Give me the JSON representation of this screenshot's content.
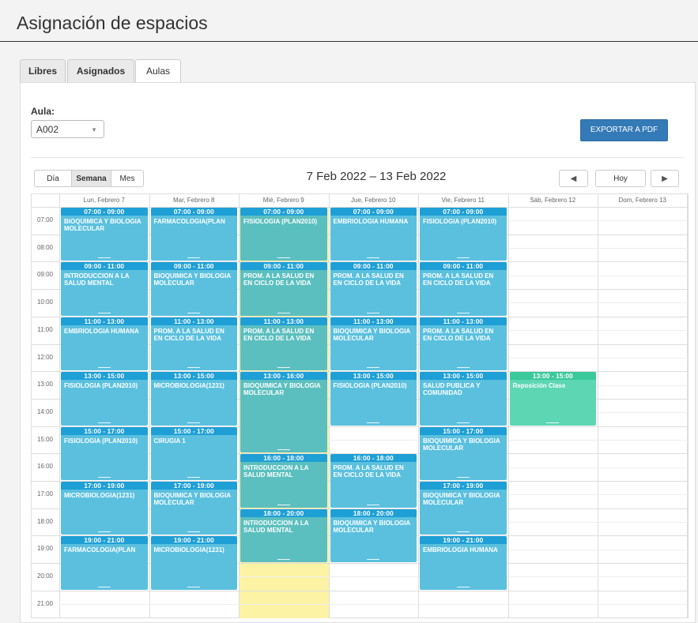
{
  "header": {
    "title": "Asignación de espacios"
  },
  "tabs": [
    {
      "label": "Libres",
      "active": false
    },
    {
      "label": "Asignados",
      "active": false
    },
    {
      "label": "Aulas",
      "active": true
    }
  ],
  "filters": {
    "aula_label": "Aula:",
    "aula_value": "A002"
  },
  "toolbar": {
    "export_label": "EXPORTAR A PDF",
    "view_buttons": [
      "Día",
      "Semana",
      "Mes"
    ],
    "selected_view": "Semana",
    "date_range": "7 Feb 2022 – 13 Feb 2022",
    "prev_icon": "◀",
    "today_label": "Hoy",
    "next_icon": "▶"
  },
  "colors": {
    "event_blue": "#5bc0de",
    "event_blue_header": "#1e9fd6",
    "event_teal": "#5cbfbf",
    "event_green": "#5dd6b4",
    "event_green_header": "#39c99a",
    "highlight_yellow": "#fcf3a4",
    "accent": "#337ab7"
  },
  "calendar": {
    "days": [
      "Lun, Febrero 7",
      "Mar, Febrero 8",
      "Mié, Febrero 9",
      "Jue, Febrero 10",
      "Vie, Febrero 11",
      "Sáb, Febrero 12",
      "Dom, Febrero 13"
    ],
    "hours": [
      "07:00",
      "08:00",
      "09:00",
      "10:00",
      "11:00",
      "12:00",
      "13:00",
      "14:00",
      "15:00",
      "16:00",
      "17:00",
      "18:00",
      "19:00",
      "20:00",
      "21:00"
    ],
    "highlighted_day": 2,
    "events": [
      {
        "day": 0,
        "start": 7,
        "end": 9,
        "time": "07:00 - 09:00",
        "title": "BIOQUIMICA Y BIOLOGIA MOLECULAR",
        "color": "blue"
      },
      {
        "day": 0,
        "start": 9,
        "end": 11,
        "time": "09:00 - 11:00",
        "title": "INTRODUCCION A LA SALUD MENTAL",
        "color": "blue"
      },
      {
        "day": 0,
        "start": 11,
        "end": 13,
        "time": "11:00 - 13:00",
        "title": "EMBRIOLOGIA HUMANA",
        "color": "blue"
      },
      {
        "day": 0,
        "start": 13,
        "end": 15,
        "time": "13:00 - 15:00",
        "title": "FISIOLOGIA (PLAN2010)",
        "color": "blue"
      },
      {
        "day": 0,
        "start": 15,
        "end": 17,
        "time": "15:00 - 17:00",
        "title": "FISIOLOGIA (PLAN2010)",
        "color": "blue"
      },
      {
        "day": 0,
        "start": 17,
        "end": 19,
        "time": "17:00 - 19:00",
        "title": "MICROBIOLOGIA(1231)",
        "color": "blue"
      },
      {
        "day": 0,
        "start": 19,
        "end": 21,
        "time": "19:00 - 21:00",
        "title": "FARMACOLOGIA(PLAN",
        "color": "blue"
      },
      {
        "day": 1,
        "start": 7,
        "end": 9,
        "time": "07:00 - 09:00",
        "title": "FARMACOLOGIA(PLAN",
        "color": "blue"
      },
      {
        "day": 1,
        "start": 9,
        "end": 11,
        "time": "09:00 - 11:00",
        "title": "BIOQUIMICA Y BIOLOGIA MOLECULAR",
        "color": "blue"
      },
      {
        "day": 1,
        "start": 11,
        "end": 13,
        "time": "11:00 - 13:00",
        "title": "PROM. A LA SALUD EN EN CICLO DE LA VIDA",
        "color": "blue"
      },
      {
        "day": 1,
        "start": 13,
        "end": 15,
        "time": "13:00 - 15:00",
        "title": "MICROBIOLOGIA(1231)",
        "color": "blue"
      },
      {
        "day": 1,
        "start": 15,
        "end": 17,
        "time": "15:00 - 17:00",
        "title": "CIRUGIA 1",
        "color": "blue"
      },
      {
        "day": 1,
        "start": 17,
        "end": 19,
        "time": "17:00 - 19:00",
        "title": "BIOQUIMICA Y BIOLOGIA MOLECULAR",
        "color": "blue"
      },
      {
        "day": 1,
        "start": 19,
        "end": 21,
        "time": "19:00 - 21:00",
        "title": "MICROBIOLOGIA(1231)",
        "color": "blue"
      },
      {
        "day": 2,
        "start": 7,
        "end": 9,
        "time": "07:00 - 09:00",
        "title": "FISIOLOGIA (PLAN2010)",
        "color": "teal"
      },
      {
        "day": 2,
        "start": 9,
        "end": 11,
        "time": "09:00 - 11:00",
        "title": "PROM. A LA SALUD EN EN CICLO DE LA VIDA",
        "color": "teal"
      },
      {
        "day": 2,
        "start": 11,
        "end": 13,
        "time": "11:00 - 13:00",
        "title": "PROM. A LA SALUD EN EN CICLO DE LA VIDA",
        "color": "teal"
      },
      {
        "day": 2,
        "start": 13,
        "end": 16,
        "time": "13:00 - 16:00",
        "title": "BIOQUIMICA Y BIOLOGIA MOLECULAR",
        "color": "teal"
      },
      {
        "day": 2,
        "start": 16,
        "end": 18,
        "time": "16:00 - 18:00",
        "title": "INTRODUCCION A LA SALUD MENTAL",
        "color": "teal"
      },
      {
        "day": 2,
        "start": 18,
        "end": 20,
        "time": "18:00 - 20:00",
        "title": "INTRODUCCION A LA SALUD MENTAL",
        "color": "teal"
      },
      {
        "day": 3,
        "start": 7,
        "end": 9,
        "time": "07:00 - 09:00",
        "title": "EMBRIOLOGIA HUMANA",
        "color": "blue"
      },
      {
        "day": 3,
        "start": 9,
        "end": 11,
        "time": "09:00 - 11:00",
        "title": "PROM. A LA SALUD EN EN CICLO DE LA VIDA",
        "color": "blue"
      },
      {
        "day": 3,
        "start": 11,
        "end": 13,
        "time": "11:00 - 13:00",
        "title": "BIOQUIMICA Y BIOLOGIA MOLECULAR",
        "color": "blue"
      },
      {
        "day": 3,
        "start": 13,
        "end": 15,
        "time": "13:00 - 15:00",
        "title": "FISIOLOGIA (PLAN2010)",
        "color": "blue"
      },
      {
        "day": 3,
        "start": 16,
        "end": 18,
        "time": "16:00 - 18:00",
        "title": "PROM. A LA SALUD EN EN CICLO DE LA VIDA",
        "color": "blue"
      },
      {
        "day": 3,
        "start": 18,
        "end": 20,
        "time": "18:00 - 20:00",
        "title": "BIOQUIMICA Y BIOLOGIA MOLECULAR",
        "color": "blue"
      },
      {
        "day": 4,
        "start": 7,
        "end": 9,
        "time": "07:00 - 09:00",
        "title": "FISIOLOGIA (PLAN2010)",
        "color": "blue"
      },
      {
        "day": 4,
        "start": 9,
        "end": 11,
        "time": "09:00 - 11:00",
        "title": "PROM. A LA SALUD EN EN CICLO DE LA VIDA",
        "color": "blue"
      },
      {
        "day": 4,
        "start": 11,
        "end": 13,
        "time": "11:00 - 13:00",
        "title": "PROM. A LA SALUD EN EN CICLO DE LA VIDA",
        "color": "blue"
      },
      {
        "day": 4,
        "start": 13,
        "end": 15,
        "time": "13:00 - 15:00",
        "title": "SALUD PUBLICA Y COMUNIDAD",
        "color": "blue"
      },
      {
        "day": 4,
        "start": 15,
        "end": 17,
        "time": "15:00 - 17:00",
        "title": "BIOQUIMICA Y BIOLOGIA MOLECULAR",
        "color": "blue"
      },
      {
        "day": 4,
        "start": 17,
        "end": 19,
        "time": "17:00 - 19:00",
        "title": "BIOQUIMICA Y BIOLOGIA MOLECULAR",
        "color": "blue"
      },
      {
        "day": 4,
        "start": 19,
        "end": 21,
        "time": "19:00 - 21:00",
        "title": "EMBRIOLOGIA HUMANA",
        "color": "blue"
      },
      {
        "day": 5,
        "start": 13,
        "end": 15,
        "time": "13:00 - 15:00",
        "title": "Reposición Clase",
        "color": "green"
      }
    ]
  }
}
